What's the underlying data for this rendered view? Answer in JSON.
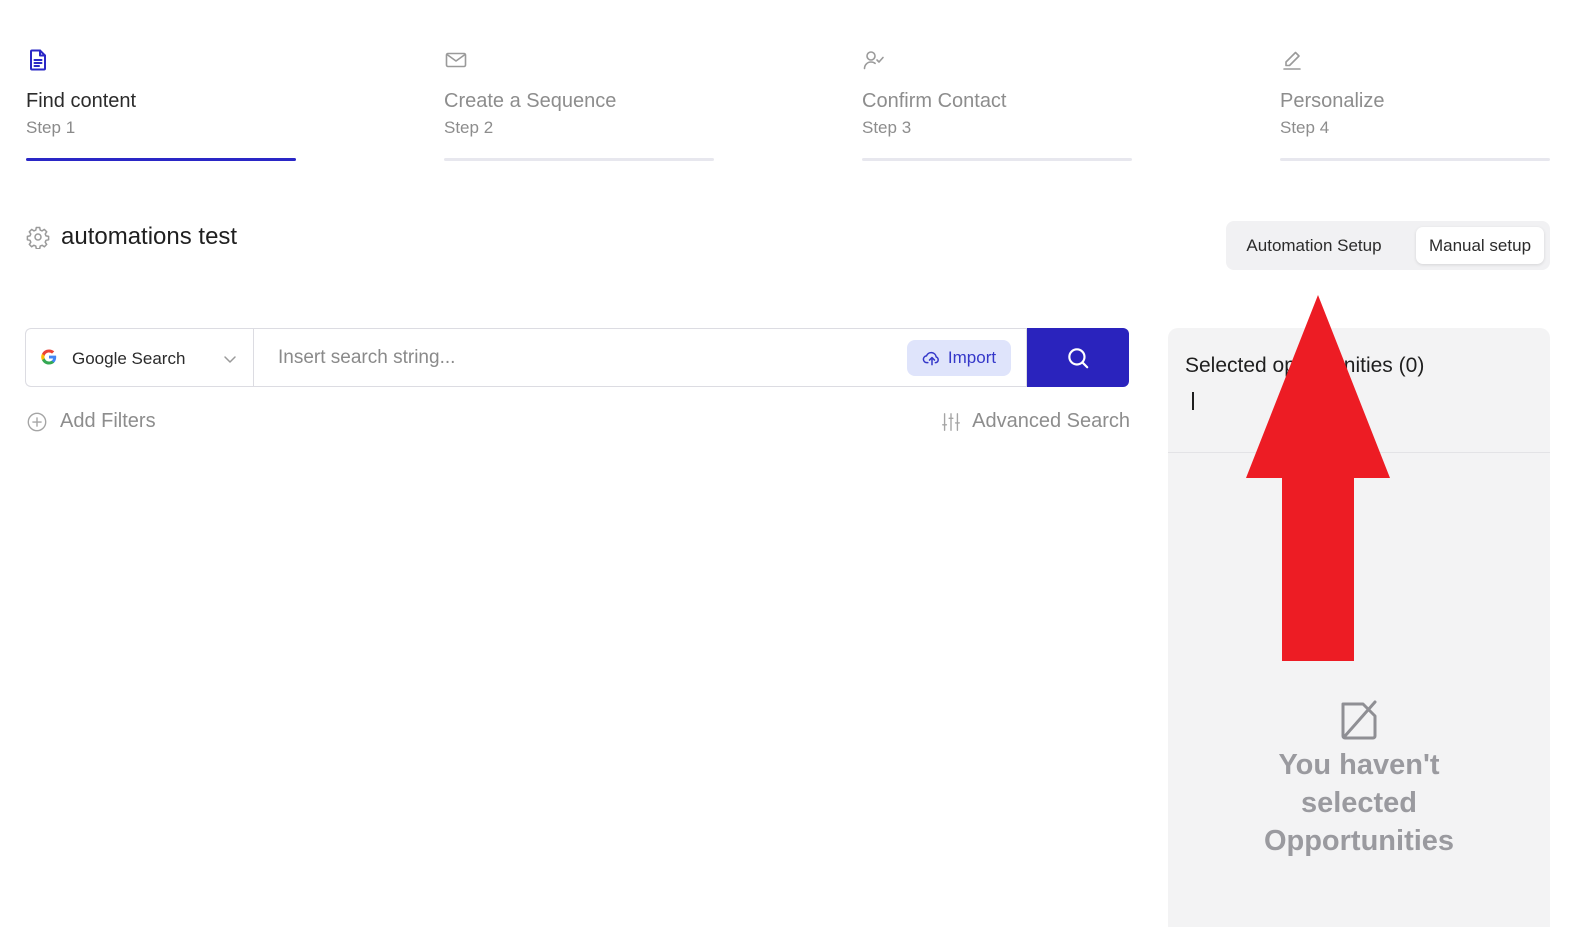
{
  "steps": [
    {
      "title": "Find content",
      "subtitle": "Step 1",
      "icon": "document-icon",
      "active": true
    },
    {
      "title": "Create a Sequence",
      "subtitle": "Step 2",
      "icon": "envelope-icon",
      "active": false
    },
    {
      "title": "Confirm Contact",
      "subtitle": "Step 3",
      "icon": "user-check-icon",
      "active": false
    },
    {
      "title": "Personalize",
      "subtitle": "Step 4",
      "icon": "pencil-icon",
      "active": false
    }
  ],
  "project": {
    "name": "automations test",
    "icon": "gear-icon"
  },
  "mode_toggle": {
    "automation_label": "Automation Setup",
    "manual_label": "Manual setup",
    "selected": "Manual setup"
  },
  "search": {
    "source_label": "Google Search",
    "source_icon": "google-icon",
    "placeholder": "Insert search string...",
    "value": "",
    "import_label": "Import",
    "import_icon": "cloud-upload-icon",
    "search_icon": "search-icon"
  },
  "filters": {
    "add_label": "Add Filters",
    "advanced_label": "Advanced Search"
  },
  "selected_panel": {
    "title": "Selected opportunities (0)",
    "empty_message": "You haven't selected Opportunities",
    "empty_icon": "no-selection-icon"
  },
  "colors": {
    "accent": "#2a23bd",
    "import_bg": "#dfe4fb",
    "panel_bg": "#f3f3f4",
    "annotation_arrow": "#ed1c24"
  }
}
